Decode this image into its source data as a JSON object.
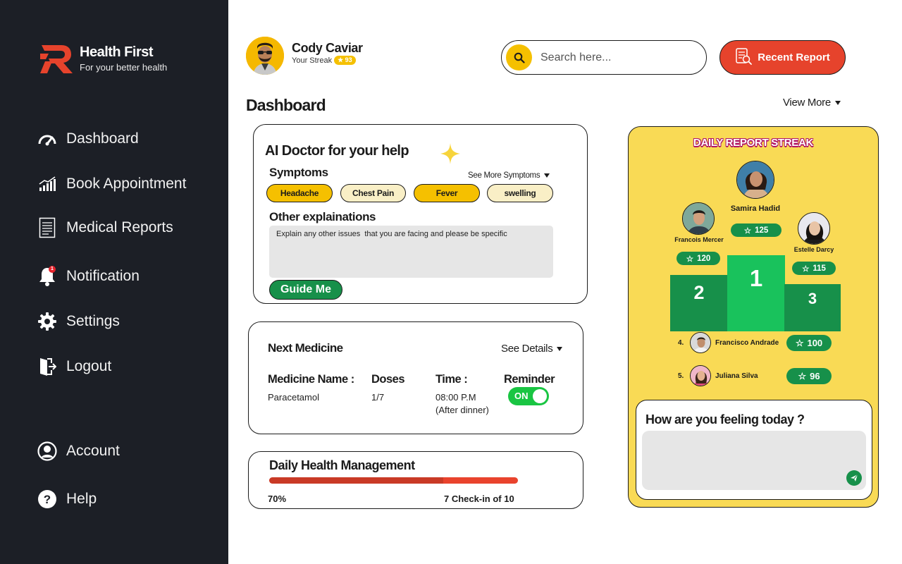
{
  "brand": {
    "name": "Health First",
    "tagline": "For your better health"
  },
  "sidebar": {
    "items": [
      {
        "label": "Dashboard",
        "icon": "gauge-icon"
      },
      {
        "label": "Book Appointment",
        "icon": "bar-chart-icon"
      },
      {
        "label": "Medical Reports",
        "icon": "document-icon"
      },
      {
        "label": "Notification",
        "icon": "bell-icon",
        "badge": "1"
      },
      {
        "label": "Settings",
        "icon": "gear-icon"
      },
      {
        "label": "Logout",
        "icon": "logout-icon"
      },
      {
        "label": "Account",
        "icon": "user-circle-icon"
      },
      {
        "label": "Help",
        "icon": "help-icon"
      }
    ]
  },
  "user": {
    "name": "Cody Caviar",
    "streak_label": "Your Streak",
    "streak_value": "93"
  },
  "search": {
    "placeholder": "Search here..."
  },
  "header": {
    "recent_report": "Recent Report"
  },
  "page": {
    "title": "Dashboard",
    "view_more": "View More"
  },
  "ai_doctor": {
    "title": "AI Doctor for your help",
    "symptoms_title": "Symptoms",
    "see_more": "See More Symptoms",
    "symptoms": [
      {
        "label": "Headache",
        "selected": true
      },
      {
        "label": "Chest Pain",
        "selected": false
      },
      {
        "label": "Fever",
        "selected": true
      },
      {
        "label": "swelling",
        "selected": false
      }
    ],
    "other_title": "Other explainations",
    "other_placeholder": "Explain any other issues  that you are facing and please be specific",
    "guide_button": "Guide Me"
  },
  "medicine": {
    "title": "Next Medicine",
    "see_details": "See Details",
    "headers": {
      "name": "Medicine Name :",
      "doses": "Doses",
      "time": "Time :",
      "reminder": "Reminder"
    },
    "name": "Paracetamol",
    "doses": "1/7",
    "time": "08:00 P.M",
    "time_note": "(After dinner)",
    "reminder": "ON"
  },
  "health": {
    "title": "Daily Health Management",
    "progress_fraction": 0.7,
    "percent": "70%",
    "checkin": "7 Check-in of 10"
  },
  "streak_board": {
    "title": "DAILY REPORT STREAK",
    "first": {
      "name": "Samira Hadid",
      "score": "125",
      "rank": "1"
    },
    "second": {
      "name": "Francois Mercer",
      "score": "120",
      "rank": "2"
    },
    "third": {
      "name": "Estelle Darcy",
      "score": "115",
      "rank": "3"
    },
    "list": [
      {
        "rank": "4.",
        "name": "Francisco Andrade",
        "score": "100"
      },
      {
        "rank": "5.",
        "name": "Juliana Silva",
        "score": "96"
      }
    ]
  },
  "feeling": {
    "title": "How are you feeling today ?"
  },
  "colors": {
    "sidebar": "#1c1f26",
    "accent_yellow": "#f5c000",
    "accent_red": "#e6432c",
    "accent_green": "#17904a",
    "panel_yellow": "#f9da55"
  }
}
